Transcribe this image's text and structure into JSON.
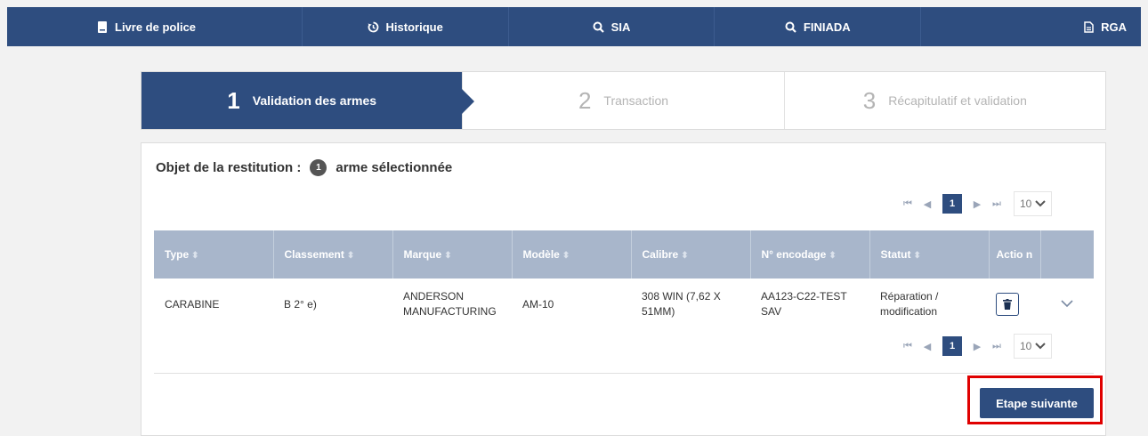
{
  "nav": {
    "items": [
      {
        "label": "Livre de police",
        "icon": "book-icon"
      },
      {
        "label": "Historique",
        "icon": "history-icon"
      },
      {
        "label": "SIA",
        "icon": "search-icon"
      },
      {
        "label": "FINIADA",
        "icon": "search-icon"
      },
      {
        "label": "RGA",
        "icon": "document-icon"
      }
    ]
  },
  "stepper": {
    "steps": [
      {
        "num": "1",
        "label": "Validation des armes",
        "active": true
      },
      {
        "num": "2",
        "label": "Transaction",
        "active": false
      },
      {
        "num": "3",
        "label": "Récapitulatif et validation",
        "active": false
      }
    ]
  },
  "panel": {
    "title_prefix": "Objet de la restitution :",
    "count": "1",
    "title_suffix": "arme sélectionnée"
  },
  "pagination": {
    "current_page": "1",
    "page_size": "10"
  },
  "table": {
    "headers": [
      "Type",
      "Classement",
      "Marque",
      "Modèle",
      "Calibre",
      "N° encodage",
      "Statut",
      "Actio n"
    ],
    "rows": [
      {
        "type": "CARABINE",
        "classement": "B 2° e)",
        "marque": "ANDERSON MANUFACTURING",
        "modele": "AM-10",
        "calibre": "308 WIN (7,62 X 51MM)",
        "encodage": "AA123-C22-TEST SAV",
        "statut": "Réparation / modification"
      }
    ]
  },
  "actions": {
    "next_label": "Etape suivante"
  },
  "colors": {
    "primary": "#2e4d7f",
    "header": "#a8b6cb",
    "highlight": "#e00000"
  }
}
